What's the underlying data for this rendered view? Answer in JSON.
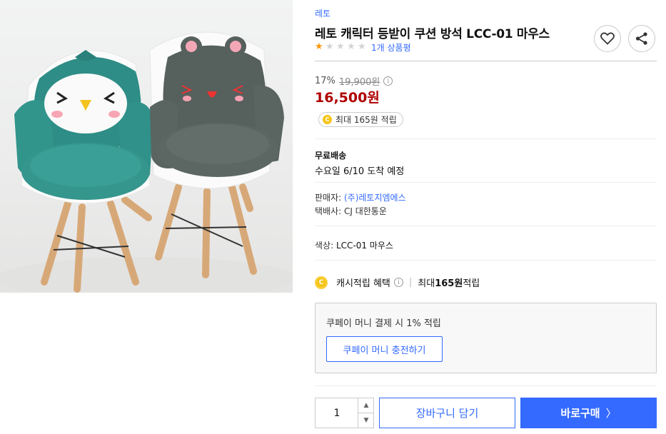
{
  "product": {
    "image_alt": "",
    "brand": "레토",
    "title": "레토 캐릭터 등받이 쿠션 방석 LCC-01 마우스",
    "rating": 1,
    "max_rating": 5,
    "review_count": "1개 상품평",
    "icons": {
      "wishlist": "heart-icon",
      "share": "share-icon"
    }
  },
  "price": {
    "discount": "17%",
    "original": "19,900원",
    "info_icon": "i",
    "sale": "16,500원",
    "cash_coin": "C",
    "cash_badge": "최대 165원 적립"
  },
  "shipping": {
    "title": "무료배송",
    "date": "수요일 6/10 도착 예정"
  },
  "seller": {
    "label": "판매자: ",
    "name": "(주)레토지엠에스",
    "carrier": "택배사: CJ 대한통운"
  },
  "option": {
    "label": "색상: ",
    "value": "LCC-01 마우스"
  },
  "cash_benefit": {
    "coin": "C",
    "label": "캐시적립 혜택",
    "info_icon": "i",
    "separator": "|",
    "text_prefix": "최대 ",
    "amount": "165원",
    "text_suffix": " 적립"
  },
  "coupay": {
    "text": "쿠페이 머니 결제 시 1% 적립",
    "button": "쿠페이 머니 충전하기"
  },
  "purchase": {
    "quantity": "1",
    "up_icon": "▲",
    "down_icon": "▼",
    "cart_label": "장바구니 담기",
    "buy_label": "바로구매",
    "buy_chevron": "〉"
  },
  "colors": {
    "accent": "#346aff",
    "sale_red": "#ae0000",
    "star": "#ff9600",
    "coin": "#f5c518"
  }
}
